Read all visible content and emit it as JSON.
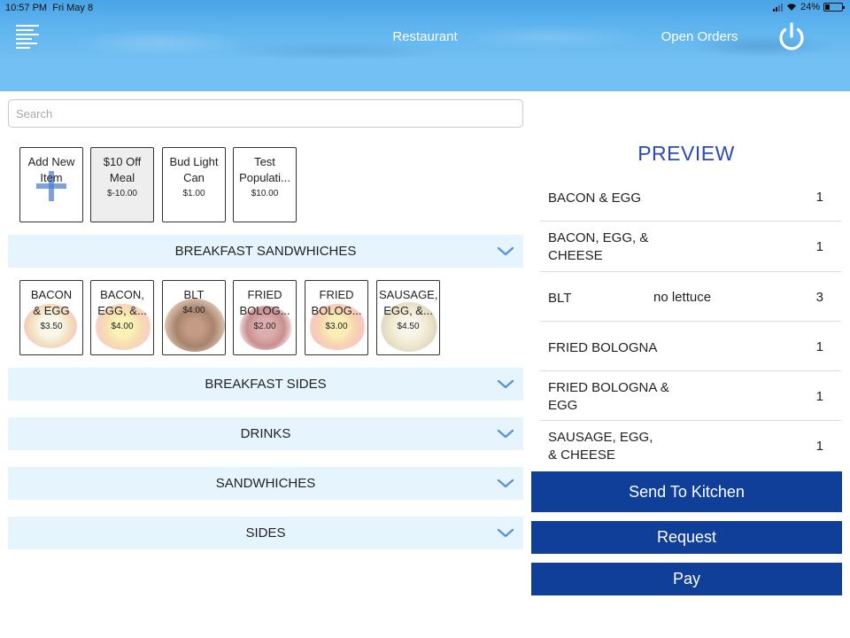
{
  "status_bar": {
    "time": "10:57 PM",
    "date": "Fri May 8",
    "battery": "24%"
  },
  "nav": {
    "title": "Restaurant",
    "open_orders": "Open Orders"
  },
  "search": {
    "placeholder": "Search"
  },
  "top_tiles": [
    {
      "name": "Add New Item",
      "price": ""
    },
    {
      "name": "$10 Off Meal",
      "price": "$-10.00"
    },
    {
      "name": "Bud Light Can",
      "price": "$1.00"
    },
    {
      "name": "Test Populati...",
      "price": "$10.00"
    }
  ],
  "categories": [
    "BREAKFAST SANDWHICHES",
    "BREAKFAST SIDES",
    "DRINKS",
    "SANDWHICHES",
    "SIDES"
  ],
  "breakfast_items": [
    {
      "name": "BACON & EGG",
      "price": "$3.50"
    },
    {
      "name": "BACON, EGG, &...",
      "price": "$4.00"
    },
    {
      "name": "BLT",
      "price": "$4.00"
    },
    {
      "name": "FRIED BOLOG...",
      "price": "$2.00"
    },
    {
      "name": "FRIED BOLOG...",
      "price": "$3.00"
    },
    {
      "name": "SAUSAGE, EGG, &...",
      "price": "$4.50"
    }
  ],
  "preview": {
    "title": "PREVIEW",
    "rows": [
      {
        "name": "BACON & EGG",
        "note": "",
        "qty": "1"
      },
      {
        "name": "BACON, EGG, & CHEESE",
        "note": "",
        "qty": "1"
      },
      {
        "name": "BLT",
        "note": "no lettuce",
        "qty": "3"
      },
      {
        "name": "FRIED BOLOGNA",
        "note": "",
        "qty": "1"
      },
      {
        "name": "FRIED BOLOGNA & EGG",
        "note": "",
        "qty": "1"
      },
      {
        "name": "SAUSAGE, EGG, & CHEESE",
        "note": "",
        "qty": "1"
      }
    ]
  },
  "actions": {
    "send_to_kitchen": "Send To Kitchen",
    "request": "Request",
    "pay": "Pay"
  },
  "colors": {
    "header": "#5eb4ef",
    "subbar": "#73c1f4",
    "category_bg": "#e6f5fd",
    "preview_title": "#2c49b4",
    "action_button": "#0f3f99",
    "chevron": "#5a93d8"
  }
}
